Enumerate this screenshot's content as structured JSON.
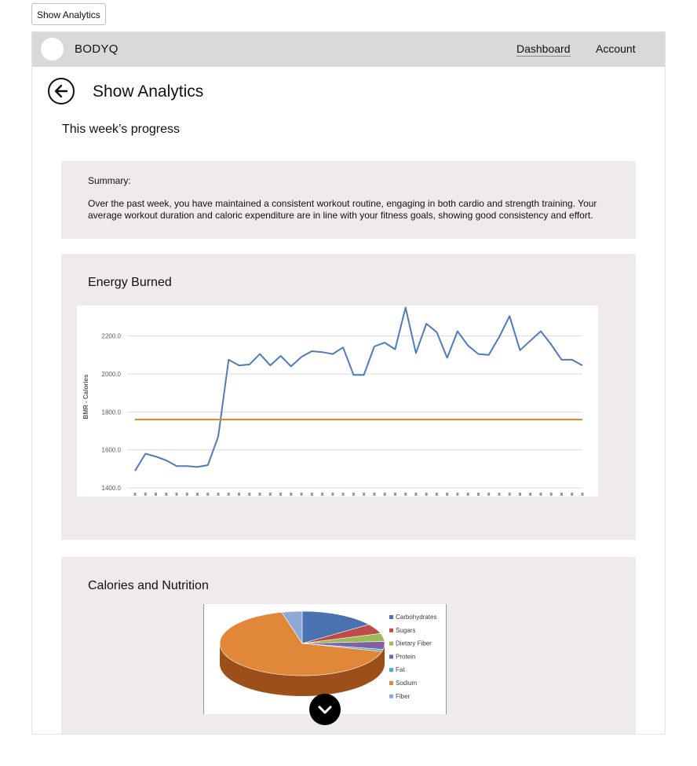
{
  "top_button": "Show Analytics",
  "header": {
    "brand": "BODYQ",
    "nav": {
      "dashboard": "Dashboard",
      "account": "Account"
    }
  },
  "page": {
    "title": "Show Analytics",
    "subtitle": "This week’s progress"
  },
  "summary": {
    "title": "Summary:",
    "body": "Over the past week, you have maintained a consistent workout routine, engaging in both cardio and strength training. Your average workout duration and caloric expenditure are in line with your fitness goals, showing good consistency and effort."
  },
  "energy_panel": {
    "title": "Energy Burned"
  },
  "nutrition_panel": {
    "title": "Calories and Nutrition"
  },
  "icons": {
    "back": "arrow-left-circle-icon",
    "scroll": "chevron-down-icon"
  },
  "colors": {
    "series_blue": "#4f7bbd",
    "series_orange": "#e08a2e",
    "panel_bg": "#eeebea",
    "header_bg": "#d9d9d9"
  },
  "chart_data": [
    {
      "type": "line",
      "title": "",
      "xlabel": "",
      "ylabel": "BMR - Calories",
      "ylim": [
        1400,
        2360
      ],
      "yticks": [
        1400.0,
        1600.0,
        1800.0,
        2000.0,
        2200.0
      ],
      "ytick_labels": [
        "1400.0",
        "1600.0",
        "1800.0",
        "2000.0",
        "2200.0"
      ],
      "grid": true,
      "series": [
        {
          "color": "#4f7bbd",
          "values": [
            1490,
            1580,
            1565,
            1545,
            1515,
            1515,
            1510,
            1520,
            1670,
            2075,
            2045,
            2050,
            2105,
            2045,
            2095,
            2040,
            2090,
            2120,
            2115,
            2105,
            2140,
            1995,
            1995,
            2145,
            2165,
            2130,
            2350,
            2110,
            2265,
            2220,
            2085,
            2225,
            2150,
            2105,
            2100,
            2195,
            2305,
            2125,
            2175,
            2225,
            2155,
            2075,
            2075,
            2045
          ]
        },
        {
          "color": "#e08a2e",
          "values": [
            1760,
            1760
          ]
        }
      ]
    },
    {
      "type": "pie",
      "title": "",
      "categories": [
        "Carbohydrates",
        "Sugars",
        "Dietary Fiber",
        "Protein",
        "Fat",
        "Sodium",
        "Fiber"
      ],
      "values": [
        15,
        5,
        4,
        4,
        1,
        67,
        4
      ],
      "colors": [
        "#4a72b0",
        "#bd4b48",
        "#9bbb59",
        "#7e62a1",
        "#4bacc6",
        "#e0873a",
        "#8fa9d6"
      ],
      "legend": "right"
    }
  ]
}
